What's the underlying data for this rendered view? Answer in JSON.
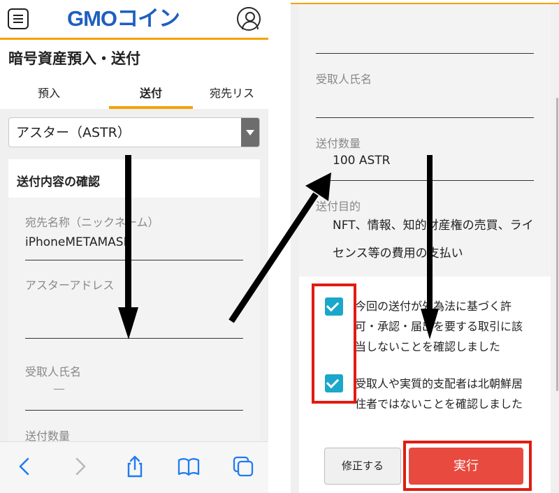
{
  "left": {
    "header": {
      "logo_gmo": "GMO",
      "logo_coin": "コイン"
    },
    "page_title": "暗号資産預入・送付",
    "tabs": [
      "預入",
      "送付",
      "宛先リス"
    ],
    "asset_select_value": "アスター（ASTR）",
    "card_title": "送付内容の確認",
    "fields": [
      {
        "label": "宛先名称（ニックネーム）",
        "value": "iPhoneMETAMASK"
      },
      {
        "label": "アスターアドレス",
        "value": ""
      },
      {
        "label": "受取人氏名",
        "value": "—"
      },
      {
        "label": "送付数量",
        "value": ""
      }
    ]
  },
  "right": {
    "fields": [
      {
        "label": "受取人氏名",
        "value": ""
      },
      {
        "label": "送付数量",
        "value": "100 ASTR"
      },
      {
        "label": "送付目的",
        "value": "NFT、情報、知的財産権の売買、ライセンス等の費用の支払い"
      }
    ],
    "checkboxes": [
      {
        "label": "今回の送付が外為法に基づく許可・承認・届出を要する取引に該当しないことを確認しました",
        "checked": true
      },
      {
        "label": "受取人や実質的支配者は北朝鮮居住者ではないことを確認しました",
        "checked": true
      }
    ],
    "buttons": {
      "fix": "修正する",
      "execute": "実行"
    }
  },
  "colors": {
    "accent": "#f5a200",
    "logo_blue": "#1f5fbf",
    "check": "#1aa7c9",
    "execute": "#e84a3f",
    "highlight": "#e01c10"
  }
}
